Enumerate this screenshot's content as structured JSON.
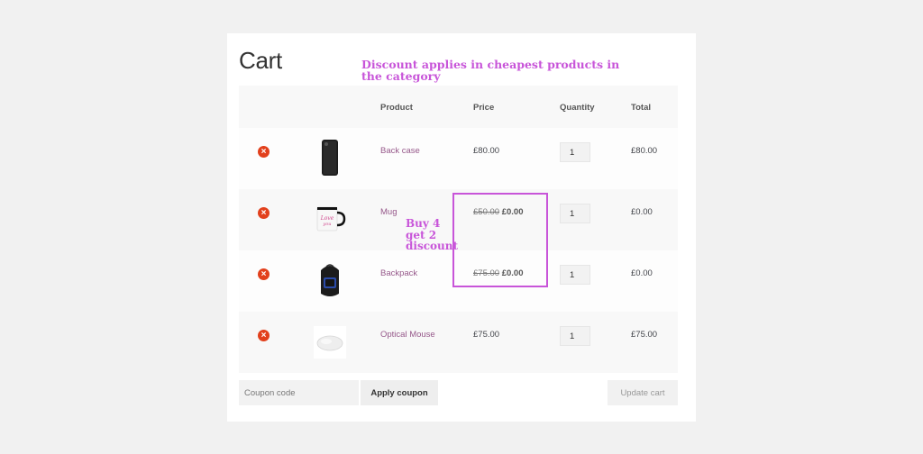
{
  "page": {
    "title": "Cart"
  },
  "annotations": {
    "top_note": "Discount applies in cheapest products in the category",
    "side_note": "Buy 4 get 2 discount",
    "highlight_color": "#c855d9"
  },
  "table": {
    "headers": {
      "product": "Product",
      "price": "Price",
      "quantity": "Quantity",
      "total": "Total"
    },
    "rows": [
      {
        "name": "Back case",
        "image": "phone-case-image",
        "price": "£80.00",
        "old_price": "",
        "new_price": "",
        "quantity": "1",
        "total": "£80.00"
      },
      {
        "name": "Mug",
        "image": "mug-image",
        "price": "",
        "old_price": "£50.00",
        "new_price": "£0.00",
        "quantity": "1",
        "total": "£0.00"
      },
      {
        "name": "Backpack",
        "image": "backpack-image",
        "price": "",
        "old_price": "£75.00",
        "new_price": "£0.00",
        "quantity": "1",
        "total": "£0.00"
      },
      {
        "name": "Optical Mouse",
        "image": "mouse-image",
        "price": "£75.00",
        "old_price": "",
        "new_price": "",
        "quantity": "1",
        "total": "£75.00"
      }
    ]
  },
  "actions": {
    "coupon_placeholder": "Coupon code",
    "apply_label": "Apply coupon",
    "update_label": "Update cart"
  },
  "colors": {
    "link": "#96588a",
    "remove": "#e2401c",
    "background": "#f1f1f1"
  }
}
